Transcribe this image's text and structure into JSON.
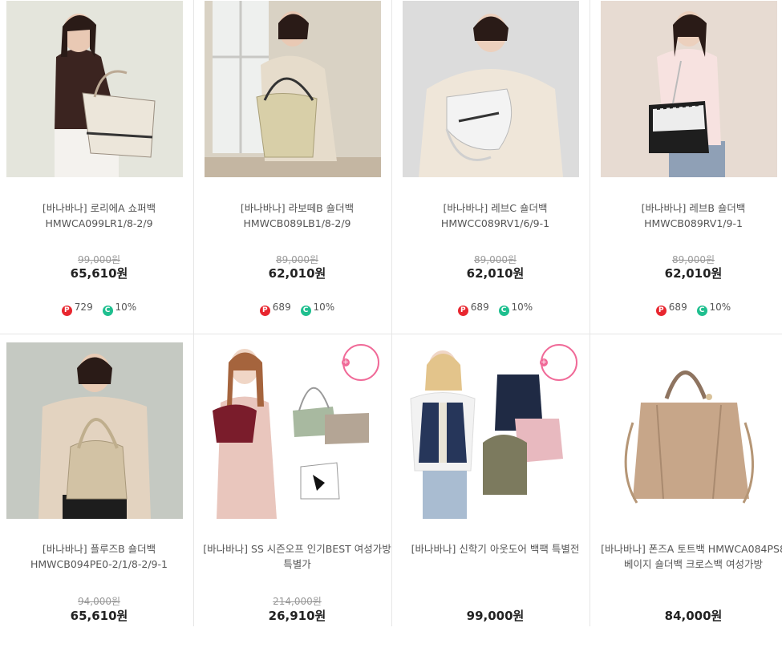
{
  "products": [
    {
      "title_line1": "[바나바나] 로리에A 쇼퍼백",
      "title_line2": "HMWCA099LR1/8-2/9",
      "original_price": "99,000원",
      "price": "65,610원",
      "point_label": "P",
      "points": "729",
      "coupon_label": "C",
      "discount": "10%",
      "image": "model-with-white-tote-bag"
    },
    {
      "title_line1": "[바나바나] 라보떼B 숄더백",
      "title_line2": "HMWCB089LB1/8-2/9",
      "original_price": "89,000원",
      "price": "62,010원",
      "point_label": "P",
      "points": "689",
      "coupon_label": "C",
      "discount": "10%",
      "image": "model-with-beige-shoulder-bag"
    },
    {
      "title_line1": "[바나바나] 레브C 숄더백",
      "title_line2": "HMWCC089RV1/6/9-1",
      "original_price": "89,000원",
      "price": "62,010원",
      "point_label": "P",
      "points": "689",
      "coupon_label": "C",
      "discount": "10%",
      "image": "model-with-white-saddle-bag"
    },
    {
      "title_line1": "[바나바나] 레브B 숄더백",
      "title_line2": "HMWCB089RV1/9-1",
      "original_price": "89,000원",
      "price": "62,010원",
      "point_label": "P",
      "points": "689",
      "coupon_label": "C",
      "discount": "10%",
      "image": "model-with-black-quilted-bag"
    },
    {
      "title_line1": "[바나바나] 플루즈B 숄더백",
      "title_line2": "HMWCB094PE0-2/1/8-2/9-1",
      "original_price": "94,000원",
      "price": "65,610원",
      "image": "model-with-beige-hobo-bag"
    },
    {
      "title_line1": "[바나바나] SS 시즌오프 인기BEST 여성가방",
      "title_line2": "특별가",
      "original_price": "214,000원",
      "price": "26,910원",
      "image": "model-with-assorted-bags"
    },
    {
      "title_line1": "[바나바나] 신학기 아웃도어 백팩 특별전",
      "title_line2": "",
      "original_price": "",
      "price": "99,000원",
      "image": "model-with-backpacks"
    },
    {
      "title_line1": "[바나바나] 폰즈A 토트백 HMWCA084PS8",
      "title_line2": "베이지 숄더백 크로스백 여성가방",
      "original_price": "",
      "price": "84,000원",
      "image": "beige-tote-bag"
    }
  ]
}
